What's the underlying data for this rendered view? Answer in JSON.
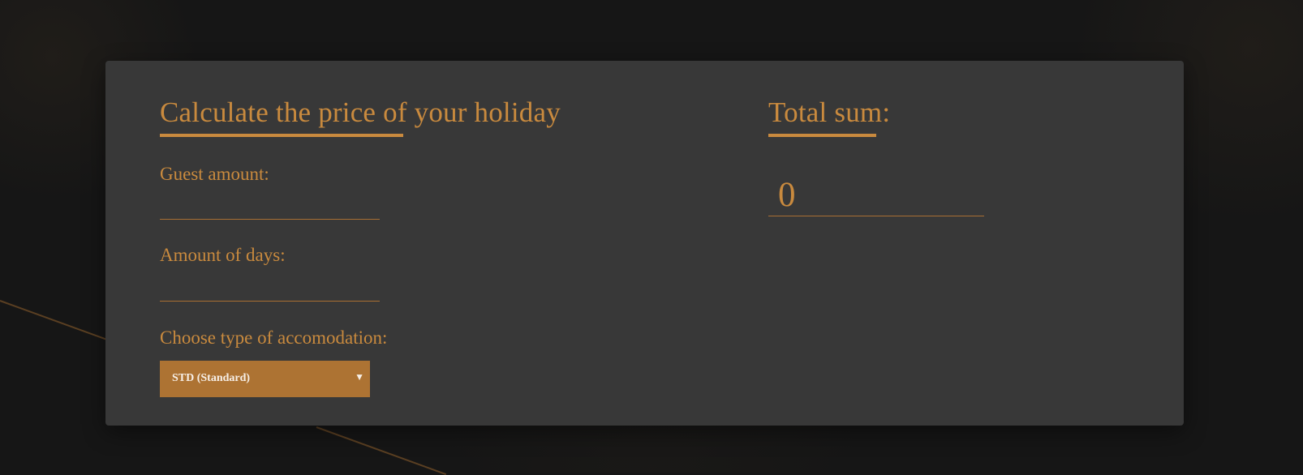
{
  "calculator": {
    "title": "Calculate the price of your holiday",
    "guest_label": "Guest amount:",
    "guest_value": "",
    "days_label": "Amount of days:",
    "days_value": "",
    "accommodation_label": "Choose type of accomodation:",
    "accommodation_selected": "STD (Standard)"
  },
  "total": {
    "title": "Total sum:",
    "value": "0"
  },
  "colors": {
    "accent": "#c98a3e",
    "card": "#383838",
    "background": "#161616",
    "select": "#ad7333"
  },
  "icons": {
    "select_arrow": "chevron-down-icon"
  }
}
